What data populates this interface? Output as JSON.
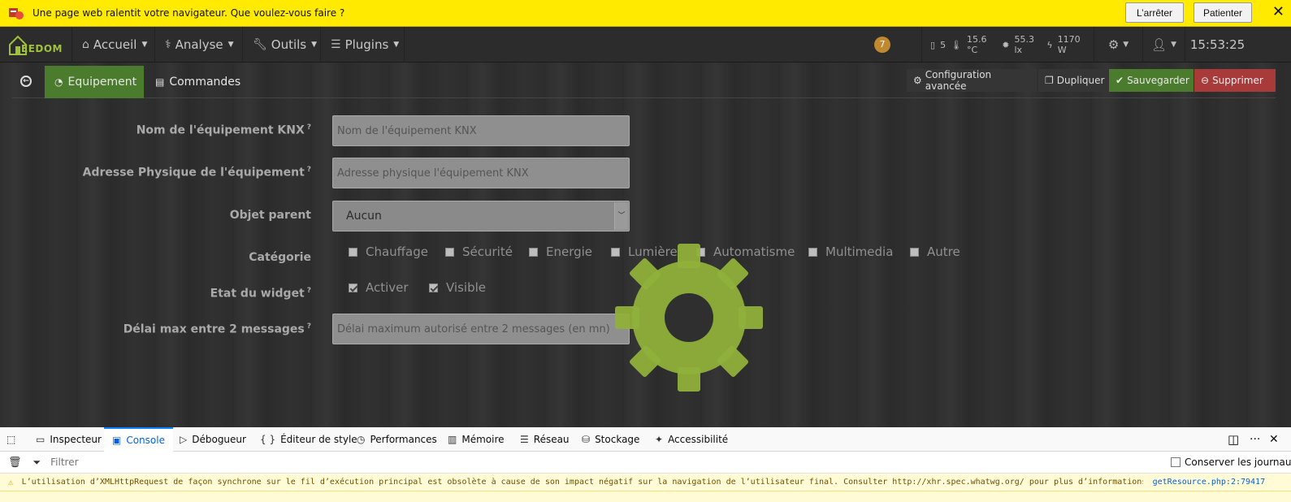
{
  "notification": {
    "message": "Une page web ralentit votre navigateur. Que voulez-vous faire ?",
    "stop_label": "L’arrêter",
    "wait_label": "Patienter"
  },
  "navbar": {
    "logo_text": "EEDOM",
    "menus": [
      {
        "label": "Accueil"
      },
      {
        "label": "Analyse"
      },
      {
        "label": "Outils"
      },
      {
        "label": "Plugins"
      }
    ],
    "badge": "7",
    "sensors": {
      "door": "5",
      "temperature": "15.6 °C",
      "luminosity": "55.3 lx",
      "power": "1170 W"
    },
    "clock": "15:53:25"
  },
  "tabs": {
    "equipement": "Equipement",
    "commandes": "Commandes"
  },
  "actions": {
    "config": "Configuration avancée",
    "duplicate": "Dupliquer",
    "save": "Sauvegarder",
    "delete": "Supprimer"
  },
  "form": {
    "name_label": "Nom de l'équipement KNX",
    "name_placeholder": "Nom de l'équipement KNX",
    "address_label": "Adresse Physique de l'équipement",
    "address_placeholder": "Adresse physique l'équipement KNX",
    "parent_label": "Objet parent",
    "parent_value": "Aucun",
    "category_label": "Catégorie",
    "categories": [
      "Chauffage",
      "Sécurité",
      "Energie",
      "Lumière",
      "Automatisme",
      "Multimedia",
      "Autre"
    ],
    "widget_label": "Etat du widget",
    "widget_options": [
      "Activer",
      "Visible"
    ],
    "delay_label": "Délai max entre 2 messages",
    "delay_placeholder": "Délai maximum autorisé entre 2 messages (en mn)"
  },
  "devtools": {
    "tabs": [
      "Inspecteur",
      "Console",
      "Débogueur",
      "Éditeur de style",
      "Performances",
      "Mémoire",
      "Réseau",
      "Stockage",
      "Accessibilité"
    ],
    "active_tab": "Console",
    "filter_placeholder": "Filtrer",
    "persist_label": "Conserver les journaux",
    "message": "L’utilisation d’XMLHttpRequest de façon synchrone sur le fil d’exécution principal est obsolète à cause de son impact négatif sur la navigation de l’utilisateur final. Consulter http://xhr.spec.whatwg.org/ pour plus d’informations.",
    "message_source": "getResource.php:2:79417"
  },
  "colors": {
    "notification_bg": "#ffea00",
    "accent_green": "#4b7b2d",
    "danger_red": "#a83a3a",
    "gear_green": "#8fb03a"
  }
}
